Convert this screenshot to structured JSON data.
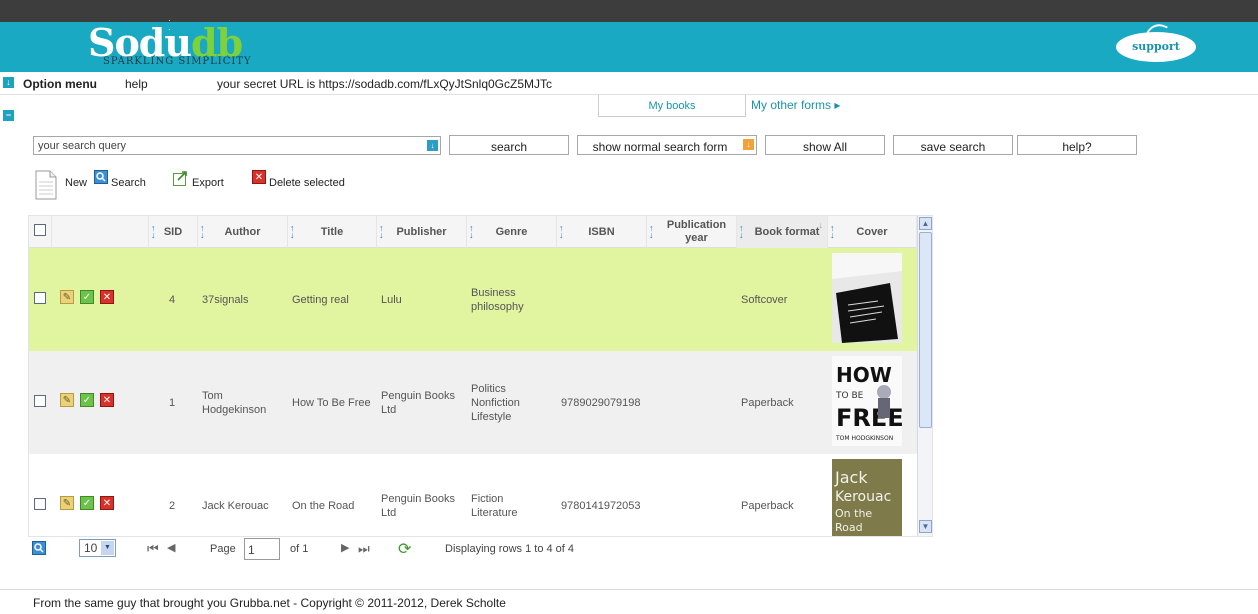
{
  "brand": {
    "logo_part1": "Sodu",
    "logo_part2": "db",
    "tagline": "SPARKLING SIMPLICITY",
    "support_label": "support",
    "banner_color": "#19a9c3"
  },
  "option_bar": {
    "option_menu": "Option menu",
    "help": "help",
    "secret_url": "your secret URL is https://sodadb.com/fLxQyJtSnlq0GcZ5MJTc"
  },
  "tabs": {
    "active": "My books",
    "other": "My other forms"
  },
  "search": {
    "placeholder": "your search query",
    "search_btn": "search",
    "normal_form_btn": "show normal search form",
    "show_all_btn": "show All",
    "save_btn": "save search",
    "help_btn": "help?"
  },
  "toolbar": {
    "new": "New",
    "search": "Search",
    "export": "Export",
    "delete": "Delete selected"
  },
  "table": {
    "columns": [
      "SID",
      "Author",
      "Title",
      "Publisher",
      "Genre",
      "ISBN",
      "Publication year",
      "Book format",
      "Cover"
    ],
    "rows": [
      {
        "sid": "4",
        "author": "37signals",
        "title": "Getting real",
        "publisher": "Lulu",
        "genre": "Business philosophy",
        "isbn": "",
        "year": "",
        "format": "Softcover",
        "highlight": true
      },
      {
        "sid": "1",
        "author": "Tom Hodgekinson",
        "title": "How To Be Free",
        "publisher": "Penguin Books Ltd",
        "genre": "Politics Nonfiction Lifestyle",
        "isbn": "9789029079198",
        "year": "",
        "format": "Paperback",
        "highlight": false
      },
      {
        "sid": "2",
        "author": "Jack Kerouac",
        "title": "On the Road",
        "publisher": "Penguin Books Ltd",
        "genre": "Fiction Literature",
        "isbn": "9780141972053",
        "year": "",
        "format": "Paperback",
        "highlight": false
      }
    ],
    "highlight_color": "#e1f5a0",
    "alt_row_color": "#f0f0f0"
  },
  "pager": {
    "rows_per_page": "10",
    "page_label": "Page",
    "page_value": "1",
    "of_label": "of 1",
    "status": "Displaying rows 1 to 4 of 4"
  },
  "footer": {
    "text1": "From the same guy that brought you ",
    "link1": "Grubba.net",
    "text2": " - Copyright © 2011-2012, ",
    "link2": "Derek Scholte"
  }
}
